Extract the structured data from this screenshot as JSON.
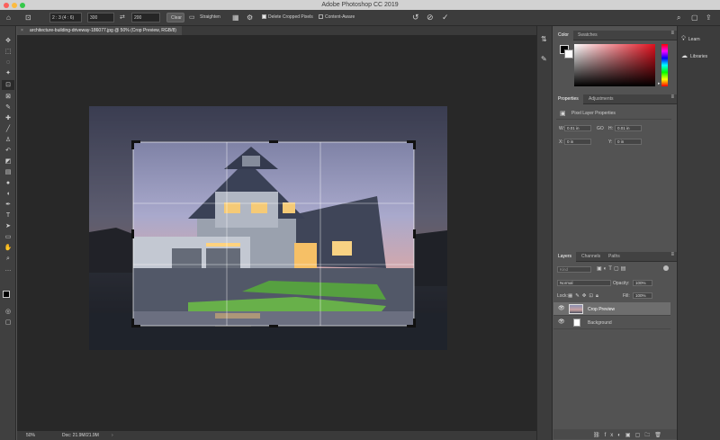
{
  "window": {
    "title": "Adobe Photoshop CC 2019"
  },
  "options_bar": {
    "ratio": "2 : 3 (4 : 6)",
    "width": "300",
    "height": "200",
    "clear_label": "Clear",
    "straighten_label": "Straighten",
    "delete_cropped_label": "Delete Cropped Pixels",
    "content_aware_label": "Content-Aware"
  },
  "document": {
    "tab_title": "architecture-building-driveway-186077.jpg @ 50% (Crop Preview, RGB/8)",
    "zoom": "50%",
    "doc_info": "Doc: 21.9M/21.9M"
  },
  "color_panel": {
    "tabs": [
      "Color",
      "Swatches"
    ]
  },
  "properties_panel": {
    "tabs": [
      "Properties",
      "Adjustments"
    ],
    "section_title": "Pixel Layer Properties",
    "w_label": "W:",
    "w_value": "0.01 in",
    "h_label": "H:",
    "h_value": "0.01 in",
    "x_label": "X:",
    "x_value": "0 in",
    "y_label": "Y:",
    "y_value": "0 in",
    "link_label": "GO"
  },
  "layers_panel": {
    "tabs": [
      "Layers",
      "Channels",
      "Paths"
    ],
    "kind_placeholder": "Kind",
    "blend_mode": "Normal",
    "opacity_label": "Opacity:",
    "opacity_value": "100%",
    "lock_label": "Lock:",
    "fill_label": "Fill:",
    "fill_value": "100%",
    "layers": [
      {
        "name": "Crop Preview",
        "selected": true
      },
      {
        "name": "Background",
        "selected": false
      }
    ]
  },
  "right_dock": {
    "learn_label": "Learn",
    "libraries_label": "Libraries"
  },
  "colors": {
    "accent": "#4d83e0",
    "workspace": "#282828"
  }
}
